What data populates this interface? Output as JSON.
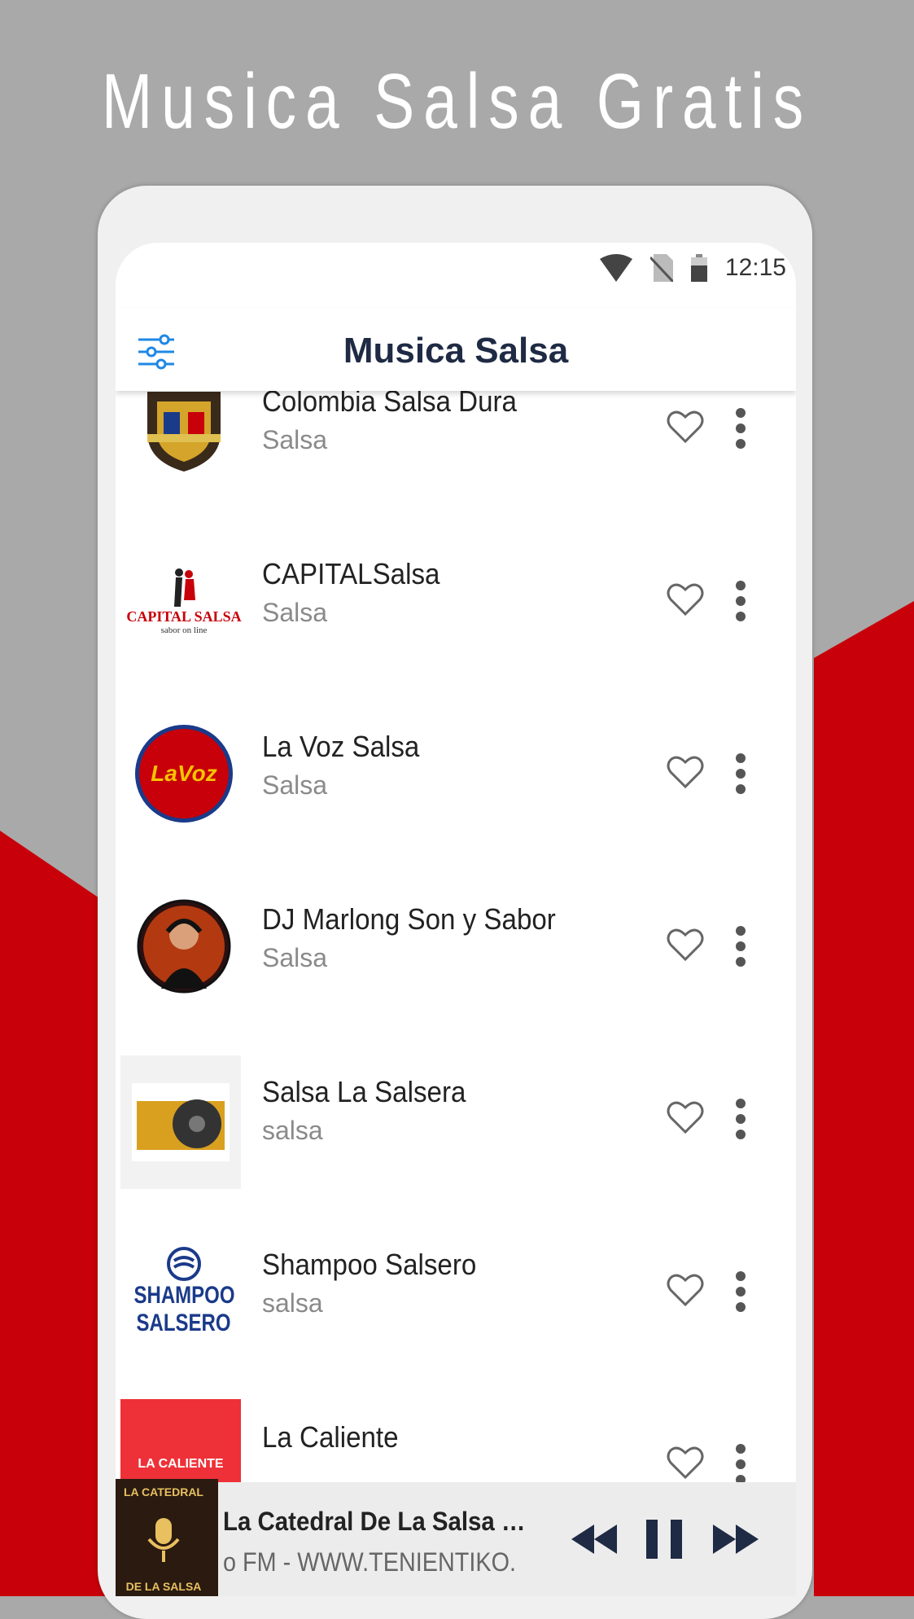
{
  "promo": {
    "title": "Musica Salsa Gratis"
  },
  "colors": {
    "red": "#c8000a",
    "gray": "#a9a9a9",
    "title": "#1f2a44",
    "accent": "#1e88e5"
  },
  "status_bar": {
    "time": "12:15",
    "icons": [
      "wifi-icon",
      "no-sim-icon",
      "battery-icon"
    ]
  },
  "app_bar": {
    "title": "Musica Salsa",
    "menu_icon": "equalizer-icon"
  },
  "stations": [
    {
      "name": "Colombia Salsa Dura",
      "genre": "Salsa"
    },
    {
      "name": "CAPITALSalsa",
      "genre": "Salsa"
    },
    {
      "name": "La Voz Salsa",
      "genre": "Salsa"
    },
    {
      "name": "DJ Marlong Son y Sabor",
      "genre": "Salsa"
    },
    {
      "name": "Salsa La Salsera",
      "genre": "salsa"
    },
    {
      "name": "Shampoo Salsero",
      "genre": "salsa"
    },
    {
      "name": "La Caliente",
      "genre": ""
    }
  ],
  "logos": {
    "capital": "CAPITAL SALSA",
    "capital_sub": "sabor on line",
    "lavoz": "LaVoz",
    "shampoo_1": "SHAMPOO",
    "shampoo_2": "SALSERO",
    "caliente": "LA CALIENTE",
    "catedral_1": "LA CATEDRAL",
    "catedral_2": "DE LA SALSA"
  },
  "player": {
    "title": "La Catedral De La Salsa Rad...",
    "subtitle": "o FM - WWW.TENIENTIKO.COM",
    "controls": [
      "rewind-icon",
      "pause-icon",
      "fast-forward-icon"
    ]
  }
}
